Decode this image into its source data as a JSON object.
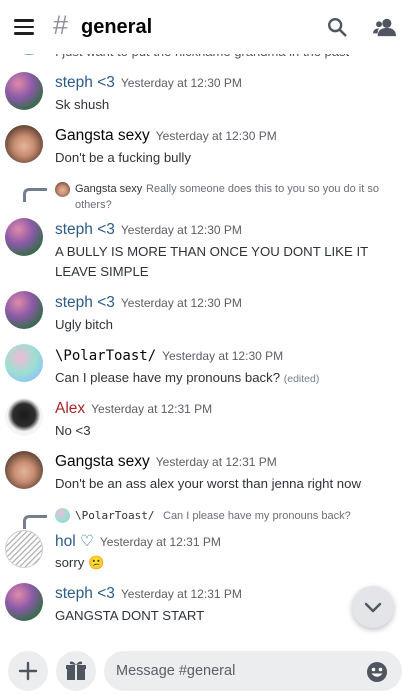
{
  "header": {
    "channel_name": "general",
    "hash": "#"
  },
  "clipped_message": {
    "text": "I just want to put the nickname grandma in the past"
  },
  "messages": [
    {
      "user": "steph <3",
      "user_color": "#2b5c87",
      "time": "Yesterday at 12:30 PM",
      "text": "Sk shush"
    },
    {
      "user": "Gangsta sexy",
      "user_color": "#060607",
      "time": "Yesterday at 12:30 PM",
      "text": "Don't be a fucking bully"
    },
    {
      "user": "steph <3",
      "user_color": "#2b5c87",
      "time": "Yesterday at 12:30 PM",
      "text": "A BULLY IS MORE THAN ONCE YOU DONT LIKE IT LEAVE SIMPLE",
      "reply_to": {
        "user": "Gangsta sexy",
        "text": "Really someone does this to you so you do it so others?"
      }
    },
    {
      "user": "steph <3",
      "user_color": "#2b5c87",
      "time": "Yesterday at 12:30 PM",
      "text": "Ugly bitch"
    },
    {
      "user": "\\PolarToast/",
      "user_color": "#060607",
      "time": "Yesterday at 12:30 PM",
      "text": "Can I please have my pronouns back?",
      "edited": "(edited)"
    },
    {
      "user": "Alex",
      "user_color": "#a8262b",
      "time": "Yesterday at 12:31 PM",
      "text": "No <3"
    },
    {
      "user": "Gangsta sexy",
      "user_color": "#060607",
      "time": "Yesterday at 12:31 PM",
      "text": "Don't be an ass alex your worst than jenna right now"
    },
    {
      "user": "hol ♡",
      "user_color": "#2b5c87",
      "time": "Yesterday at 12:31 PM",
      "text": "sorry 😕",
      "reply_to": {
        "user": "\\PolarToast/",
        "text": "Can I please have my pronouns back?"
      }
    },
    {
      "user": "steph <3",
      "user_color": "#2b5c87",
      "time": "Yesterday at 12:31 PM",
      "text": "GANGSTA DONT START"
    }
  ],
  "composer": {
    "placeholder": "Message #general"
  },
  "icons": {
    "menu": "hamburger-icon",
    "search": "search-icon",
    "members": "members-icon",
    "scroll_down": "chevron-down-icon",
    "attach": "plus-icon",
    "gift": "gift-icon",
    "emoji": "emoji-icon"
  }
}
